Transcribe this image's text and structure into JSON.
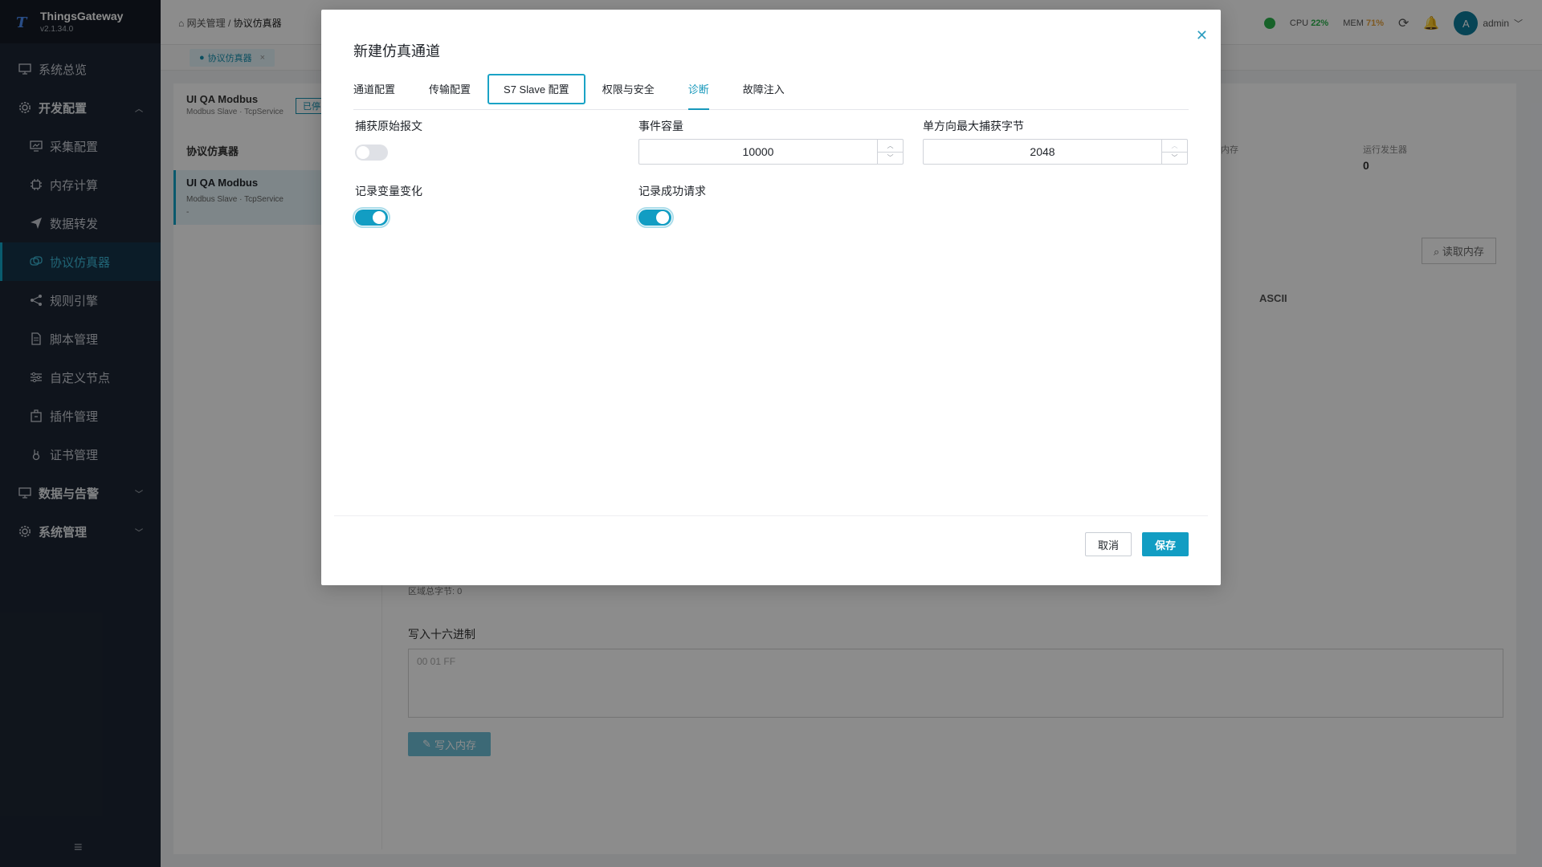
{
  "app": {
    "name": "ThingsGateway",
    "version": "v2.1.34.0"
  },
  "sidebar": {
    "items": [
      {
        "label": "系统总览",
        "icon": "monitor-icon"
      },
      {
        "label": "开发配置",
        "icon": "gear-icon"
      },
      {
        "label": "采集配置",
        "icon": "monitor-chart-icon"
      },
      {
        "label": "内存计算",
        "icon": "chip-icon"
      },
      {
        "label": "数据转发",
        "icon": "send-icon"
      },
      {
        "label": "协议仿真器",
        "icon": "simulator-icon"
      },
      {
        "label": "规则引擎",
        "icon": "share-icon"
      },
      {
        "label": "脚本管理",
        "icon": "document-icon"
      },
      {
        "label": "自定义节点",
        "icon": "sliders-icon"
      },
      {
        "label": "插件管理",
        "icon": "plugin-icon"
      },
      {
        "label": "证书管理",
        "icon": "certificate-icon"
      },
      {
        "label": "数据与告警",
        "icon": "monitor-icon"
      },
      {
        "label": "系统管理",
        "icon": "gear-icon"
      }
    ]
  },
  "topbar": {
    "breadcrumb_root": "网关管理",
    "breadcrumb_sep": "/",
    "breadcrumb_current": "协议仿真器",
    "cpu_label": "CPU",
    "cpu_value": "22%",
    "mem_label": "MEM",
    "mem_value": "71%",
    "avatar_letter": "A",
    "username": "admin"
  },
  "page_tab": {
    "label": "协议仿真器"
  },
  "background": {
    "header_title": "UI QA Modbus",
    "header_sub": "Modbus Slave · TcpService",
    "list_title": "协议仿真器",
    "item_title": "UI QA Modbus",
    "item_sub": "Modbus Slave · TcpService",
    "item_dash": "-",
    "status_badge": "已停",
    "stat_mem": "内存",
    "stat_gen_label": "运行发生器",
    "stat_gen_value": "0",
    "read_memory": "读取内存",
    "col_ascii": "ASCII",
    "area_bytes": "区域总字节: 0",
    "write_hex_label": "写入十六进制",
    "write_hex_placeholder": "00 01 FF",
    "write_memory_button": "写入内存"
  },
  "modal": {
    "title": "新建仿真通道",
    "tabs": [
      "通道配置",
      "传输配置",
      "S7 Slave 配置",
      "权限与安全",
      "诊断",
      "故障注入"
    ],
    "active_tab": "诊断",
    "fields": {
      "capture_raw": {
        "label": "捕获原始报文",
        "on": false
      },
      "event_capacity": {
        "label": "事件容量",
        "value": "10000"
      },
      "max_capture_bytes": {
        "label": "单方向最大捕获字节",
        "value": "2048"
      },
      "record_var_change": {
        "label": "记录变量变化",
        "on": true
      },
      "record_success": {
        "label": "记录成功请求",
        "on": true
      }
    },
    "cancel_label": "取消",
    "save_label": "保存"
  },
  "colors": {
    "accent": "#129dc3",
    "sidebar_bg": "#1d2633",
    "cpu_ok": "#2bb24c",
    "mem_warn": "#e6a23c"
  }
}
